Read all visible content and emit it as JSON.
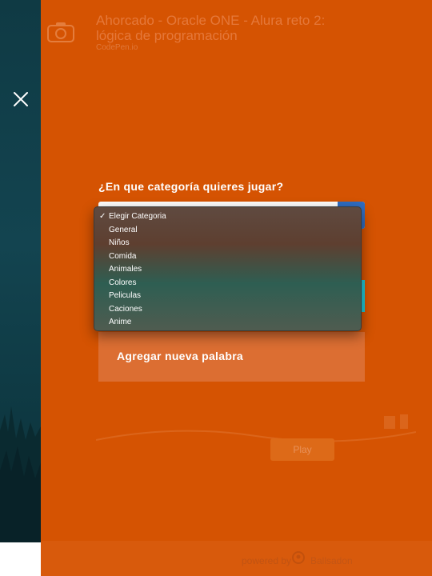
{
  "background": {
    "title": "Ahorcado - Oracle ONE - Alura reto 2: lógica de programación",
    "subtitle": "CodePen.io",
    "play_label": "Play",
    "powered_by": "powered by",
    "powered_brand": "Ballsadon"
  },
  "modal": {
    "question": "¿En que categoría quieres jugar?",
    "add_word_label": "Agregar nueva palabra",
    "dropdown": {
      "selected": "Elegir Categoria",
      "options": [
        "Elegir Categoria",
        "General",
        "Niños",
        "Comida",
        "Animales",
        "Colores",
        "Peliculas",
        "Caciones",
        "Anime"
      ]
    }
  },
  "colors": {
    "overlay": "#d55302",
    "accent_blue": "#2f6dc2",
    "accent_cyan": "#1ec8d8"
  },
  "icons": {
    "close": "close-icon",
    "logo": "camera-logo-icon",
    "check": "checkmark-icon"
  }
}
